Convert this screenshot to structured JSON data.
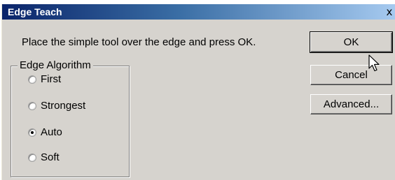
{
  "dialog": {
    "title": "Edge Teach",
    "close_glyph": "x",
    "instruction": "Place the simple tool over the edge and press OK."
  },
  "edge_algorithm": {
    "group_label": "Edge Algorithm",
    "options": [
      {
        "label": "First",
        "selected": false
      },
      {
        "label": "Strongest",
        "selected": false
      },
      {
        "label": "Auto",
        "selected": true
      },
      {
        "label": "Soft",
        "selected": false
      }
    ]
  },
  "buttons": {
    "ok_label": "OK",
    "cancel_label": "Cancel",
    "advanced_label": "Advanced..."
  },
  "icons": {
    "close": "close-icon",
    "pointer": "mouse-pointer-icon"
  },
  "colors": {
    "dialog_face": "#d6d3ce",
    "title_bar_start": "#0a246a",
    "title_bar_end": "#a6caf0",
    "title_text": "#ffffff"
  }
}
